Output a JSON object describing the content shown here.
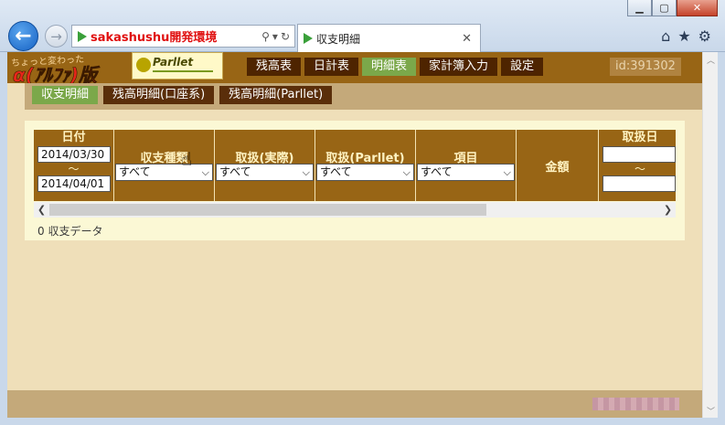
{
  "browser": {
    "address_text": "sakashushu開発環境",
    "tab_title": "収支明細",
    "tab_close": "✕",
    "window_buttons": [
      "minimize-icon",
      "maximize-icon",
      "close-icon"
    ]
  },
  "site": {
    "logo_small_text": "ちょっと変わった",
    "logo_big_text": "α(ｱﾙﾌｧ)版",
    "logo_parllet_text": "Parllet",
    "nav": [
      "残高表",
      "日計表",
      "明細表",
      "家計簿入力",
      "設定"
    ],
    "nav_active": "明細表",
    "user_id": "id:391302"
  },
  "subtabs": [
    "収支明細",
    "残高明細(口座系)",
    "残高明細(Parllet)"
  ],
  "subtab_active": "収支明細",
  "filter": {
    "col_date": "日付",
    "date_from": "2014/03/30",
    "tilde": "～",
    "date_to": "2014/04/01",
    "col_kind": "収支種類",
    "col_handling_actual": "取扱(実際)",
    "col_handling_parllet": "取扱(Parllet)",
    "col_item": "項目",
    "col_amount": "金額",
    "col_handle_date": "取扱日",
    "select_all": "すべて"
  },
  "result_count": "0 収支データ",
  "colors": {
    "header": "#986515",
    "active_tab": "#7ba84a",
    "page_bg": "#efdfb9"
  }
}
